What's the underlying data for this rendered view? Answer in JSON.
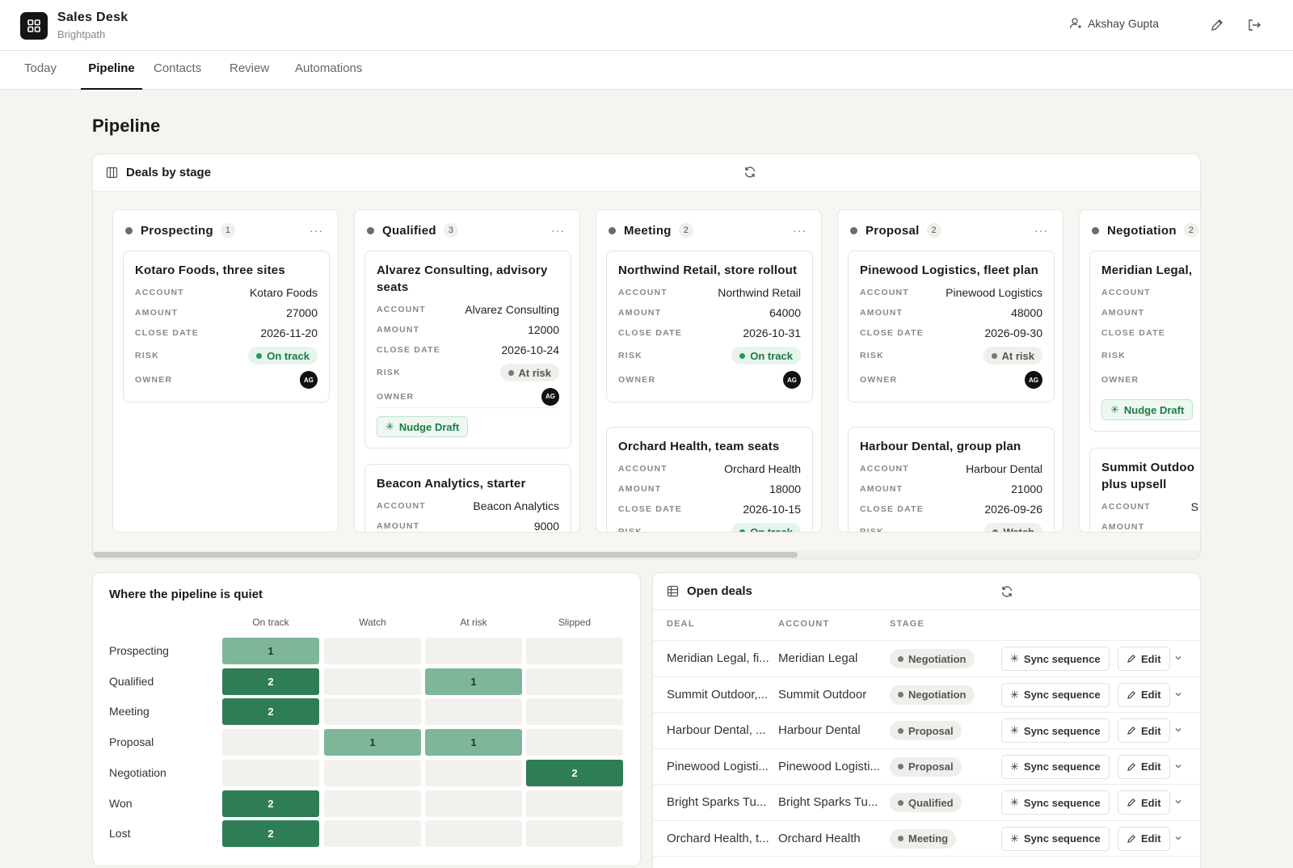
{
  "app": {
    "name": "Sales Desk",
    "org": "Brightpath",
    "user": "Akshay Gupta"
  },
  "tabs": [
    "Today",
    "Pipeline",
    "Contacts",
    "Review",
    "Automations"
  ],
  "page_title": "Pipeline",
  "board": {
    "title": "Deals by stage",
    "labels": {
      "account": "ACCOUNT",
      "amount": "AMOUNT",
      "close": "CLOSE DATE",
      "risk": "RISK",
      "owner": "OWNER"
    },
    "nudge": "Nudge Draft",
    "columns": [
      {
        "name": "Prospecting",
        "count": "1",
        "deals": [
          {
            "title": "Kotaro Foods, three sites",
            "account": "Kotaro Foods",
            "amount": "27000",
            "close": "2026-11-20",
            "risk": "On track",
            "owner": "AG"
          }
        ]
      },
      {
        "name": "Qualified",
        "count": "3",
        "deals": [
          {
            "title": "Alvarez Consulting, advisory seats",
            "account": "Alvarez Consulting",
            "amount": "12000",
            "close": "2026-10-24",
            "risk": "At risk",
            "owner": "AG"
          },
          {
            "title": "Beacon Analytics, starter",
            "account": "Beacon Analytics",
            "amount": "9000"
          }
        ]
      },
      {
        "name": "Meeting",
        "count": "2",
        "deals": [
          {
            "title": "Northwind Retail, store rollout",
            "account": "Northwind Retail",
            "amount": "64000",
            "close": "2026-10-31",
            "risk": "On track",
            "owner": "AG"
          },
          {
            "title": "Orchard Health, team seats",
            "account": "Orchard Health",
            "amount": "18000",
            "close": "2026-10-15",
            "risk": "On track"
          }
        ]
      },
      {
        "name": "Proposal",
        "count": "2",
        "deals": [
          {
            "title": "Pinewood Logistics, fleet plan",
            "account": "Pinewood Logistics",
            "amount": "48000",
            "close": "2026-09-30",
            "risk": "At risk",
            "owner": "AG"
          },
          {
            "title": "Harbour Dental, group plan",
            "account": "Harbour Dental",
            "amount": "21000",
            "close": "2026-09-26",
            "risk": "Watch"
          }
        ]
      },
      {
        "name": "Negotiation",
        "count": "2",
        "deals": [
          {
            "title": "Meridian Legal,"
          },
          {
            "title": "Summit Outdoo plus upsell",
            "account": "S"
          }
        ]
      }
    ]
  },
  "heatmap": {
    "title": "Where the pipeline is quiet",
    "columns": [
      "On track",
      "Watch",
      "At risk",
      "Slipped"
    ],
    "rows": [
      {
        "label": "Prospecting",
        "cells": [
          "1",
          "",
          "",
          ""
        ]
      },
      {
        "label": "Qualified",
        "cells": [
          "2",
          "",
          "1",
          ""
        ]
      },
      {
        "label": "Meeting",
        "cells": [
          "2",
          "",
          "",
          ""
        ]
      },
      {
        "label": "Proposal",
        "cells": [
          "",
          "1",
          "1",
          ""
        ]
      },
      {
        "label": "Negotiation",
        "cells": [
          "",
          "",
          "",
          "2"
        ]
      },
      {
        "label": "Won",
        "cells": [
          "2",
          "",
          "",
          ""
        ]
      },
      {
        "label": "Lost",
        "cells": [
          "2",
          "",
          "",
          ""
        ]
      }
    ]
  },
  "open_deals": {
    "title": "Open deals",
    "headers": [
      "DEAL",
      "ACCOUNT",
      "STAGE"
    ],
    "sync_label": "Sync sequence",
    "edit_label": "Edit",
    "rows": [
      {
        "deal": "Meridian Legal, fi...",
        "account": "Meridian Legal",
        "stage": "Negotiation"
      },
      {
        "deal": "Summit Outdoor,...",
        "account": "Summit Outdoor",
        "stage": "Negotiation"
      },
      {
        "deal": "Harbour Dental, ...",
        "account": "Harbour Dental",
        "stage": "Proposal"
      },
      {
        "deal": "Pinewood Logisti...",
        "account": "Pinewood Logisti...",
        "stage": "Proposal"
      },
      {
        "deal": "Bright Sparks Tu...",
        "account": "Bright Sparks Tu...",
        "stage": "Qualified"
      },
      {
        "deal": "Orchard Health, t...",
        "account": "Orchard Health",
        "stage": "Meeting"
      }
    ]
  }
}
